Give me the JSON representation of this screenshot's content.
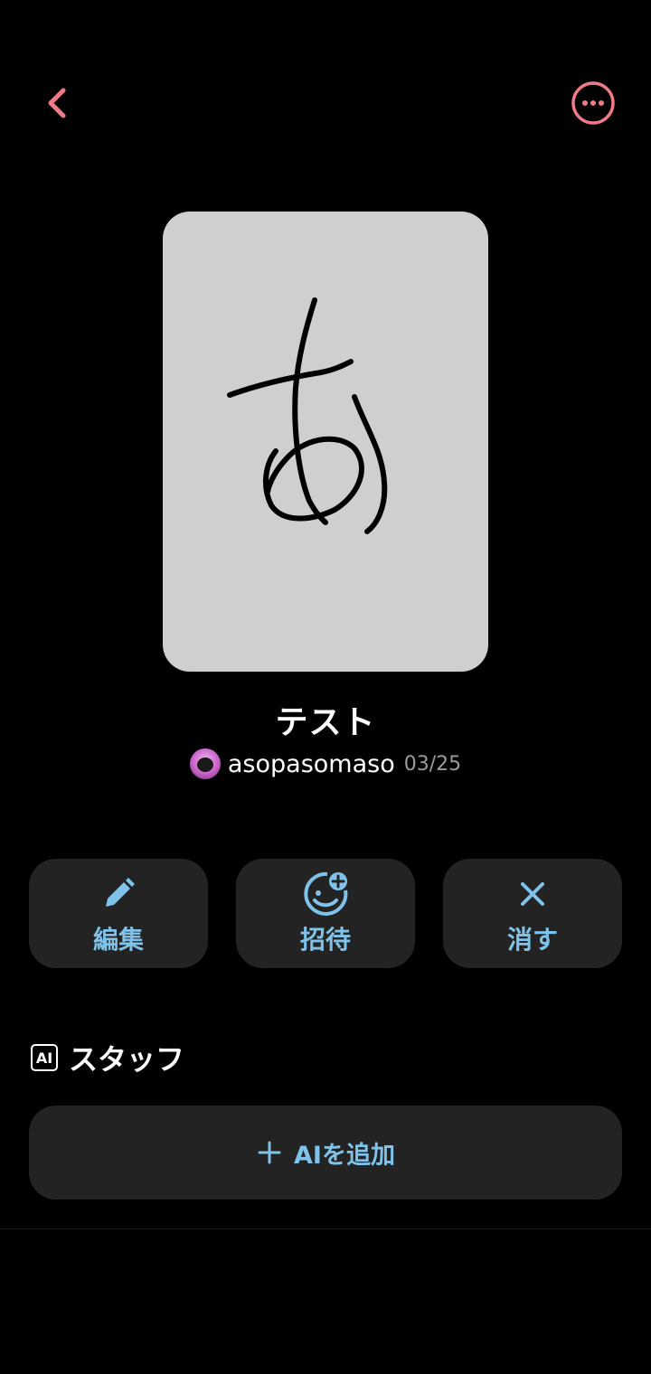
{
  "header": {
    "back_icon": "chevron-left-icon",
    "more_icon": "more-horizontal-circle-icon",
    "accent_color": "#f07b86"
  },
  "card": {
    "art_background": "#cfcfcf",
    "art_description_icon": "handwritten-a-hiragana"
  },
  "room": {
    "title": "テスト",
    "owner_name": "asopasomaso",
    "date": "03/25"
  },
  "actions": [
    {
      "label": "編集",
      "icon": "pencil-icon"
    },
    {
      "label": "招待",
      "icon": "invite-smile-plus-icon"
    },
    {
      "label": "消す",
      "icon": "close-icon"
    }
  ],
  "staff_section": {
    "badge": "AI",
    "title": "スタッフ",
    "add_button_label": "AIを追加",
    "add_icon": "plus-icon"
  },
  "colors": {
    "action_text": "#7fc3ea",
    "button_bg": "#232323",
    "background": "#000000"
  }
}
